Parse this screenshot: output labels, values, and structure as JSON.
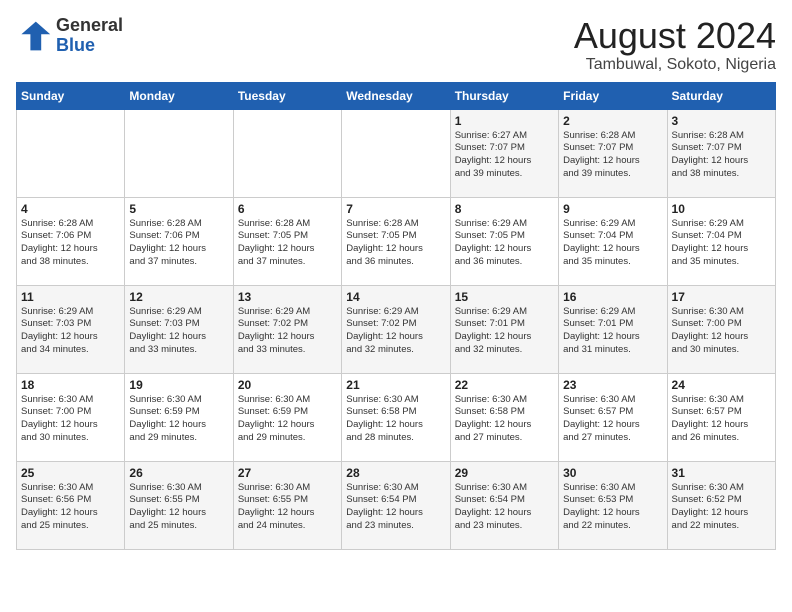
{
  "logo": {
    "text_general": "General",
    "text_blue": "Blue"
  },
  "calendar": {
    "title": "August 2024",
    "subtitle": "Tambuwal, Sokoto, Nigeria",
    "days_of_week": [
      "Sunday",
      "Monday",
      "Tuesday",
      "Wednesday",
      "Thursday",
      "Friday",
      "Saturday"
    ],
    "weeks": [
      [
        {
          "day": "",
          "info": ""
        },
        {
          "day": "",
          "info": ""
        },
        {
          "day": "",
          "info": ""
        },
        {
          "day": "",
          "info": ""
        },
        {
          "day": "1",
          "info": "Sunrise: 6:27 AM\nSunset: 7:07 PM\nDaylight: 12 hours\nand 39 minutes."
        },
        {
          "day": "2",
          "info": "Sunrise: 6:28 AM\nSunset: 7:07 PM\nDaylight: 12 hours\nand 39 minutes."
        },
        {
          "day": "3",
          "info": "Sunrise: 6:28 AM\nSunset: 7:07 PM\nDaylight: 12 hours\nand 38 minutes."
        }
      ],
      [
        {
          "day": "4",
          "info": "Sunrise: 6:28 AM\nSunset: 7:06 PM\nDaylight: 12 hours\nand 38 minutes."
        },
        {
          "day": "5",
          "info": "Sunrise: 6:28 AM\nSunset: 7:06 PM\nDaylight: 12 hours\nand 37 minutes."
        },
        {
          "day": "6",
          "info": "Sunrise: 6:28 AM\nSunset: 7:05 PM\nDaylight: 12 hours\nand 37 minutes."
        },
        {
          "day": "7",
          "info": "Sunrise: 6:28 AM\nSunset: 7:05 PM\nDaylight: 12 hours\nand 36 minutes."
        },
        {
          "day": "8",
          "info": "Sunrise: 6:29 AM\nSunset: 7:05 PM\nDaylight: 12 hours\nand 36 minutes."
        },
        {
          "day": "9",
          "info": "Sunrise: 6:29 AM\nSunset: 7:04 PM\nDaylight: 12 hours\nand 35 minutes."
        },
        {
          "day": "10",
          "info": "Sunrise: 6:29 AM\nSunset: 7:04 PM\nDaylight: 12 hours\nand 35 minutes."
        }
      ],
      [
        {
          "day": "11",
          "info": "Sunrise: 6:29 AM\nSunset: 7:03 PM\nDaylight: 12 hours\nand 34 minutes."
        },
        {
          "day": "12",
          "info": "Sunrise: 6:29 AM\nSunset: 7:03 PM\nDaylight: 12 hours\nand 33 minutes."
        },
        {
          "day": "13",
          "info": "Sunrise: 6:29 AM\nSunset: 7:02 PM\nDaylight: 12 hours\nand 33 minutes."
        },
        {
          "day": "14",
          "info": "Sunrise: 6:29 AM\nSunset: 7:02 PM\nDaylight: 12 hours\nand 32 minutes."
        },
        {
          "day": "15",
          "info": "Sunrise: 6:29 AM\nSunset: 7:01 PM\nDaylight: 12 hours\nand 32 minutes."
        },
        {
          "day": "16",
          "info": "Sunrise: 6:29 AM\nSunset: 7:01 PM\nDaylight: 12 hours\nand 31 minutes."
        },
        {
          "day": "17",
          "info": "Sunrise: 6:30 AM\nSunset: 7:00 PM\nDaylight: 12 hours\nand 30 minutes."
        }
      ],
      [
        {
          "day": "18",
          "info": "Sunrise: 6:30 AM\nSunset: 7:00 PM\nDaylight: 12 hours\nand 30 minutes."
        },
        {
          "day": "19",
          "info": "Sunrise: 6:30 AM\nSunset: 6:59 PM\nDaylight: 12 hours\nand 29 minutes."
        },
        {
          "day": "20",
          "info": "Sunrise: 6:30 AM\nSunset: 6:59 PM\nDaylight: 12 hours\nand 29 minutes."
        },
        {
          "day": "21",
          "info": "Sunrise: 6:30 AM\nSunset: 6:58 PM\nDaylight: 12 hours\nand 28 minutes."
        },
        {
          "day": "22",
          "info": "Sunrise: 6:30 AM\nSunset: 6:58 PM\nDaylight: 12 hours\nand 27 minutes."
        },
        {
          "day": "23",
          "info": "Sunrise: 6:30 AM\nSunset: 6:57 PM\nDaylight: 12 hours\nand 27 minutes."
        },
        {
          "day": "24",
          "info": "Sunrise: 6:30 AM\nSunset: 6:57 PM\nDaylight: 12 hours\nand 26 minutes."
        }
      ],
      [
        {
          "day": "25",
          "info": "Sunrise: 6:30 AM\nSunset: 6:56 PM\nDaylight: 12 hours\nand 25 minutes."
        },
        {
          "day": "26",
          "info": "Sunrise: 6:30 AM\nSunset: 6:55 PM\nDaylight: 12 hours\nand 25 minutes."
        },
        {
          "day": "27",
          "info": "Sunrise: 6:30 AM\nSunset: 6:55 PM\nDaylight: 12 hours\nand 24 minutes."
        },
        {
          "day": "28",
          "info": "Sunrise: 6:30 AM\nSunset: 6:54 PM\nDaylight: 12 hours\nand 23 minutes."
        },
        {
          "day": "29",
          "info": "Sunrise: 6:30 AM\nSunset: 6:54 PM\nDaylight: 12 hours\nand 23 minutes."
        },
        {
          "day": "30",
          "info": "Sunrise: 6:30 AM\nSunset: 6:53 PM\nDaylight: 12 hours\nand 22 minutes."
        },
        {
          "day": "31",
          "info": "Sunrise: 6:30 AM\nSunset: 6:52 PM\nDaylight: 12 hours\nand 22 minutes."
        }
      ]
    ]
  }
}
